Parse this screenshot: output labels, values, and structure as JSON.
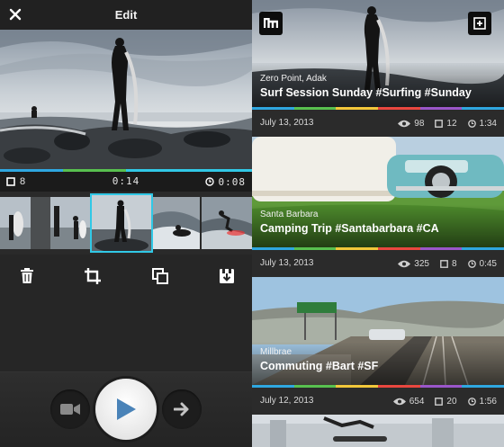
{
  "editor": {
    "title": "Edit",
    "clip_count": "8",
    "timecode": "0:14",
    "duration": "0:08",
    "icons": {
      "close": "close-icon",
      "clips": "clip-count-icon",
      "clock": "clock-icon",
      "delete": "trash-icon",
      "crop": "crop-icon",
      "duplicate": "duplicate-icon",
      "save": "save-icon",
      "camera": "video-camera-icon",
      "play": "play-icon",
      "next": "arrow-right-icon"
    },
    "accent_color": "#31c8e6"
  },
  "feed": {
    "cards": [
      {
        "location": "Zero Point, Adak",
        "title": "Surf Session Sunday #Surfing #Sunday",
        "date": "July 13, 2013",
        "views": "98",
        "clips": "12",
        "duration": "1:34"
      },
      {
        "location": "Santa Barbara",
        "title": "Camping Trip #Santabarbara #CA",
        "date": "July 13, 2013",
        "views": "325",
        "clips": "8",
        "duration": "0:45"
      },
      {
        "location": "Millbrae",
        "title": "Commuting #Bart #SF",
        "date": "July 12, 2013",
        "views": "654",
        "clips": "20",
        "duration": "1:56"
      }
    ],
    "rainbow_colors": [
      "#2fa7e0",
      "#58c04f",
      "#f2c73a",
      "#e9473f",
      "#9a56c9",
      "#2fa7e0"
    ]
  }
}
